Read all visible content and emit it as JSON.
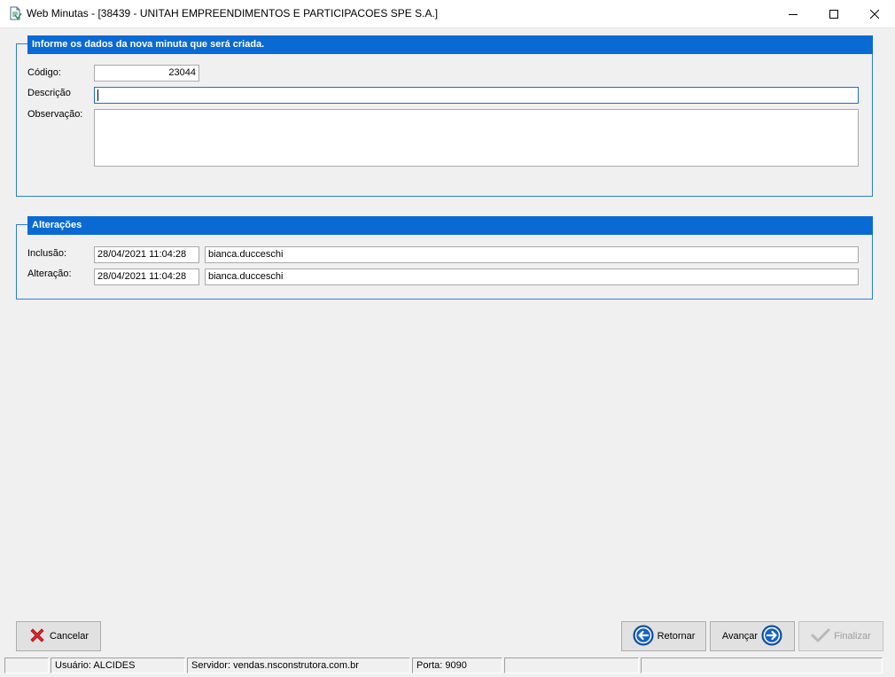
{
  "window": {
    "title": "Web Minutas - [38439 - UNITAH EMPREENDIMENTOS E PARTICIPACOES SPE S.A.]"
  },
  "section_new": {
    "header": "Informe os dados da nova minuta que será criada.",
    "codigo_label": "Código:",
    "codigo_value": "23044",
    "descricao_label": "Descrição",
    "descricao_value": "",
    "observacao_label": "Observação:",
    "observacao_value": ""
  },
  "section_changes": {
    "header": "Alterações",
    "inclusao_label": "Inclusão:",
    "inclusao_date": "28/04/2021 11:04:28",
    "inclusao_user": "bianca.ducceschi",
    "alteracao_label": "Alteração:",
    "alteracao_date": "28/04/2021 11:04:28",
    "alteracao_user": "bianca.ducceschi"
  },
  "buttons": {
    "cancel": "Cancelar",
    "back": "Retornar",
    "next": "Avançar",
    "finish": "Finalizar"
  },
  "status_bar": {
    "usuario": "Usuário: ALCIDES",
    "servidor": "Servidor: vendas.nsconstrutora.com.br",
    "porta": "Porta: 9090"
  },
  "colors": {
    "header_blue": "#0a6ad3",
    "group_border": "#2e7fd6",
    "cancel_red": "#e0262a",
    "nav_blue": "#1560c2"
  },
  "icons": {
    "app": "document-icon",
    "cancel": "red-x-icon",
    "back": "arrow-left-circle-icon",
    "next": "arrow-right-circle-icon",
    "finish": "checkmark-icon"
  }
}
